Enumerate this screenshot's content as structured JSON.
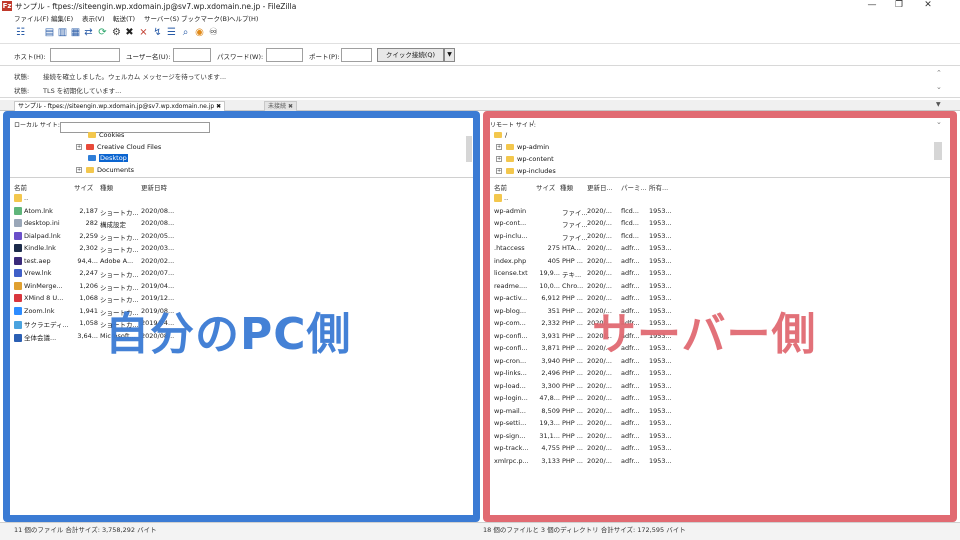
{
  "window": {
    "title": "サンプル - ftpes://siteengin.wp.xdomain.jp@sv7.wp.xdomain.ne.jp - FileZilla",
    "app_icon": "Fz",
    "controls": {
      "minimize": "—",
      "maximize": "❐",
      "close": "✕"
    }
  },
  "menu": [
    "ファイル(F)",
    "編集(E)",
    "表示(V)",
    "転送(T)",
    "サーバー(S)",
    "ブックマーク(B)",
    "ヘルプ(H)"
  ],
  "toolbar_icons": [
    "site-manager-icon",
    "toggle-log-icon",
    "toggle-local-tree-icon",
    "toggle-remote-tree-icon",
    "toggle-queue-icon",
    "refresh-icon",
    "process-queue-icon",
    "cancel-icon",
    "disconnect-icon",
    "reconnect-icon",
    "filter-icon",
    "toggle-compare-icon",
    "sync-browse-icon",
    "search-icon"
  ],
  "quickconnect": {
    "host_label": "ホスト(H):",
    "user_label": "ユーザー名(U):",
    "pass_label": "パスワード(W):",
    "port_label": "ポート(P):",
    "button": "クイック接続(Q)",
    "dropdown": "▼"
  },
  "log": [
    {
      "label": "状態:",
      "text": "接続を確立しました。ウェルカム メッセージを待っています..."
    },
    {
      "label": "状態:",
      "text": "TLS を初期化しています..."
    }
  ],
  "tabs": [
    {
      "label": "サンプル - ftpes://siteengin.wp.xdomain.jp@sv7.wp.xdomain.ne.jp",
      "close": "✖",
      "active": true
    },
    {
      "label": "未接続",
      "close": "✖",
      "active": false
    }
  ],
  "local": {
    "site_label": "ローカル サイト:",
    "tree": [
      {
        "label": "Cookies",
        "icon": "folder"
      },
      {
        "label": "Creative Cloud Files",
        "icon": "folder-cc",
        "expander": "+"
      },
      {
        "label": "Desktop",
        "icon": "folder-blue",
        "selected": true
      },
      {
        "label": "Documents",
        "icon": "folder",
        "expander": "+"
      }
    ],
    "headers": {
      "name": "名前",
      "size": "サイズ",
      "type": "種類",
      "modified": "更新日時"
    },
    "files": [
      {
        "name": "..",
        "size": "",
        "type": "",
        "modified": "",
        "icon_color": "#f3c74d"
      },
      {
        "name": "Atom.lnk",
        "size": "2,187",
        "type": "ショートカ...",
        "modified": "2020/08...",
        "icon_color": "#5fb57a"
      },
      {
        "name": "desktop.ini",
        "size": "282",
        "type": "構成設定",
        "modified": "2020/08...",
        "icon_color": "#9aa7b8"
      },
      {
        "name": "Dialpad.lnk",
        "size": "2,259",
        "type": "ショートカ...",
        "modified": "2020/05...",
        "icon_color": "#6a4fc9"
      },
      {
        "name": "Kindle.lnk",
        "size": "2,302",
        "type": "ショートカ...",
        "modified": "2020/03...",
        "icon_color": "#1c2b4a"
      },
      {
        "name": "test.aep",
        "size": "94,4...",
        "type": "Adobe A...",
        "modified": "2020/02...",
        "icon_color": "#3a2a7a"
      },
      {
        "name": "Vrew.lnk",
        "size": "2,247",
        "type": "ショートカ...",
        "modified": "2020/07...",
        "icon_color": "#3f5fc8"
      },
      {
        "name": "WinMerge...",
        "size": "1,206",
        "type": "ショートカ...",
        "modified": "2019/04...",
        "icon_color": "#e0a030"
      },
      {
        "name": "XMind 8 U...",
        "size": "1,068",
        "type": "ショートカ...",
        "modified": "2019/12...",
        "icon_color": "#d9363e"
      },
      {
        "name": "Zoom.lnk",
        "size": "1,941",
        "type": "ショートカ...",
        "modified": "2019/08...",
        "icon_color": "#2d8cff"
      },
      {
        "name": "サクラエディ...",
        "size": "1,058",
        "type": "ショートカ...",
        "modified": "2019/04...",
        "icon_color": "#4aa3df"
      },
      {
        "name": "全体会議...",
        "size": "3,64...",
        "type": "Microsoft...",
        "modified": "2020/08...",
        "icon_color": "#2b5fb3"
      }
    ],
    "status": "11 個のファイル 合計サイズ: 3,758,292 バイト"
  },
  "remote": {
    "site_label": "リモート サイト:",
    "path": "/",
    "tree": [
      {
        "label": "/",
        "icon": "folder"
      },
      {
        "label": "wp-admin",
        "icon": "folder",
        "expander": "+"
      },
      {
        "label": "wp-content",
        "icon": "folder",
        "expander": "+"
      },
      {
        "label": "wp-includes",
        "icon": "folder",
        "expander": "+"
      }
    ],
    "headers": {
      "name": "名前",
      "size": "サイズ",
      "type": "種類",
      "modified": "更新日...",
      "perm": "パーミ...",
      "owner": "所有..."
    },
    "files": [
      {
        "name": "..",
        "size": "",
        "type": "",
        "modified": "",
        "perm": "",
        "owner": ""
      },
      {
        "name": "wp-admin",
        "size": "",
        "type": "ファイ...",
        "modified": "2020/...",
        "perm": "flcd...",
        "owner": "1953..."
      },
      {
        "name": "wp-cont...",
        "size": "",
        "type": "ファイ...",
        "modified": "2020/...",
        "perm": "flcd...",
        "owner": "1953..."
      },
      {
        "name": "wp-inclu...",
        "size": "",
        "type": "ファイ...",
        "modified": "2020/...",
        "perm": "flcd...",
        "owner": "1953..."
      },
      {
        "name": ".htaccess",
        "size": "275",
        "type": "HTA...",
        "modified": "2020/...",
        "perm": "adfr...",
        "owner": "1953..."
      },
      {
        "name": "index.php",
        "size": "405",
        "type": "PHP ...",
        "modified": "2020/...",
        "perm": "adfr...",
        "owner": "1953..."
      },
      {
        "name": "license.txt",
        "size": "19,9...",
        "type": "テキ...",
        "modified": "2020/...",
        "perm": "adfr...",
        "owner": "1953..."
      },
      {
        "name": "readme....",
        "size": "10,0...",
        "type": "Chro...",
        "modified": "2020/...",
        "perm": "adfr...",
        "owner": "1953..."
      },
      {
        "name": "wp-activ...",
        "size": "6,912",
        "type": "PHP ...",
        "modified": "2020/...",
        "perm": "adfr...",
        "owner": "1953..."
      },
      {
        "name": "wp-blog...",
        "size": "351",
        "type": "PHP ...",
        "modified": "2020/...",
        "perm": "adfr...",
        "owner": "1953..."
      },
      {
        "name": "wp-com...",
        "size": "2,332",
        "type": "PHP ...",
        "modified": "2020/...",
        "perm": "adfr...",
        "owner": "1953..."
      },
      {
        "name": "wp-confi...",
        "size": "3,931",
        "type": "PHP ...",
        "modified": "2020/...",
        "perm": "adfr...",
        "owner": "1953..."
      },
      {
        "name": "wp-confi...",
        "size": "3,871",
        "type": "PHP ...",
        "modified": "2020/...",
        "perm": "adfr...",
        "owner": "1953..."
      },
      {
        "name": "wp-cron...",
        "size": "3,940",
        "type": "PHP ...",
        "modified": "2020/...",
        "perm": "adfr...",
        "owner": "1953..."
      },
      {
        "name": "wp-links...",
        "size": "2,496",
        "type": "PHP ...",
        "modified": "2020/...",
        "perm": "adfr...",
        "owner": "1953..."
      },
      {
        "name": "wp-load...",
        "size": "3,300",
        "type": "PHP ...",
        "modified": "2020/...",
        "perm": "adfr...",
        "owner": "1953..."
      },
      {
        "name": "wp-login...",
        "size": "47,8...",
        "type": "PHP ...",
        "modified": "2020/...",
        "perm": "adfr...",
        "owner": "1953..."
      },
      {
        "name": "wp-mail...",
        "size": "8,509",
        "type": "PHP ...",
        "modified": "2020/...",
        "perm": "adfr...",
        "owner": "1953..."
      },
      {
        "name": "wp-setti...",
        "size": "19,3...",
        "type": "PHP ...",
        "modified": "2020/...",
        "perm": "adfr...",
        "owner": "1953..."
      },
      {
        "name": "wp-sign...",
        "size": "31,1...",
        "type": "PHP ...",
        "modified": "2020/...",
        "perm": "adfr...",
        "owner": "1953..."
      },
      {
        "name": "wp-track...",
        "size": "4,755",
        "type": "PHP ...",
        "modified": "2020/...",
        "perm": "adfr...",
        "owner": "1953..."
      },
      {
        "name": "xmlrpc.p...",
        "size": "3,133",
        "type": "PHP ...",
        "modified": "2020/...",
        "perm": "adfr...",
        "owner": "1953..."
      }
    ],
    "status": "18 個のファイルと 3 個のディレクトリ 合計サイズ: 172,595 バイト"
  },
  "overlays": {
    "local": "自分のPC側",
    "remote": "サーバー側"
  },
  "colors": {
    "blue_frame": "#3b7bd4",
    "red_frame": "#e16a72",
    "selection": "#0a64d0"
  }
}
